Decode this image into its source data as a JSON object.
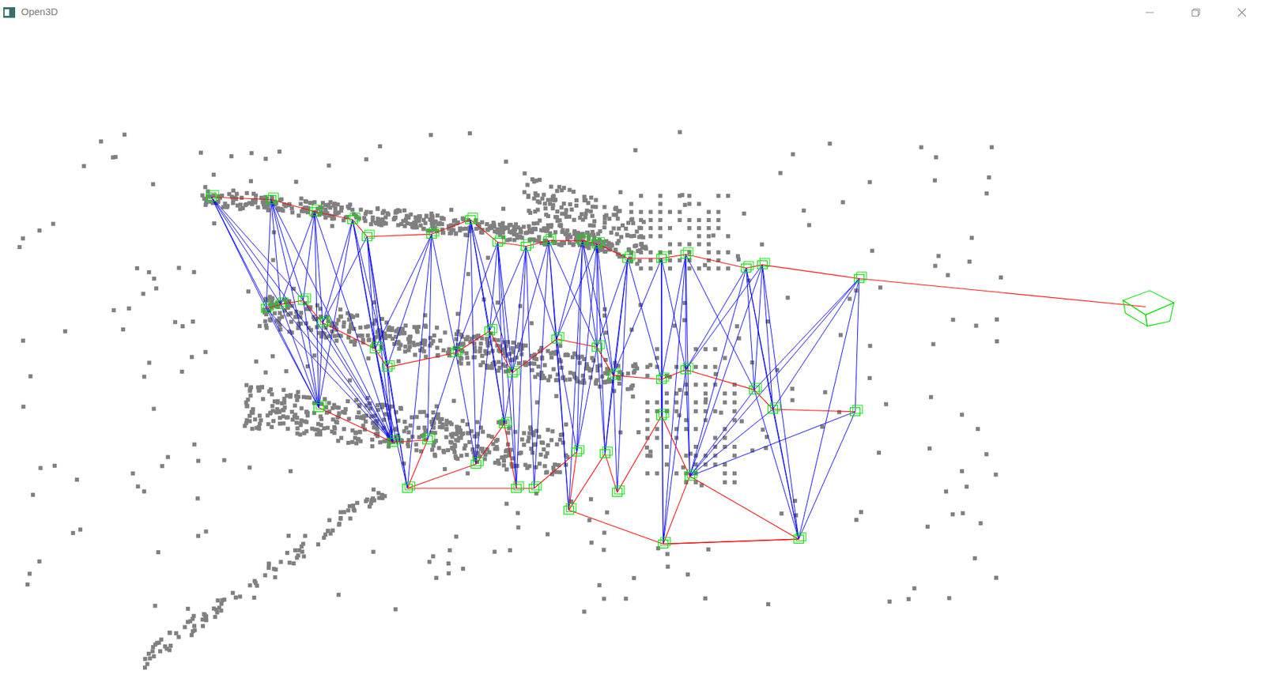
{
  "window": {
    "title": "Open3D"
  }
}
